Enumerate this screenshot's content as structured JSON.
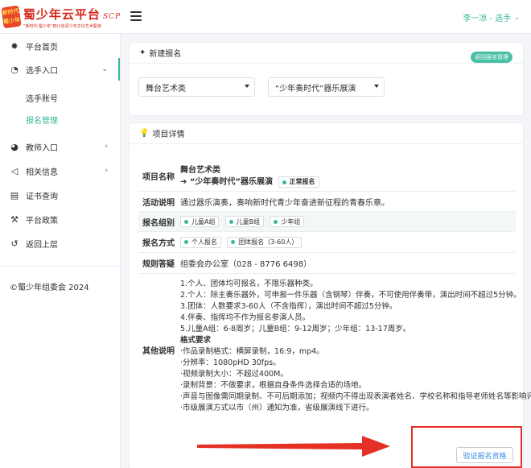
{
  "header": {
    "logo_badge": "新时代 蜀少年",
    "logo_title": "蜀少年云平台",
    "logo_scp": "SCP",
    "logo_subtitle": "“新时代·蜀少年”四川省青少年文化艺术展演",
    "user_label": "李一凉 - 选手"
  },
  "sidebar": {
    "items": [
      {
        "label": "平台首页",
        "icon": "gear-icon"
      },
      {
        "label": "选手入口",
        "icon": "dashboard-icon"
      },
      {
        "label": "教师入口",
        "icon": "palette-icon"
      },
      {
        "label": "相关信息",
        "icon": "megaphone-icon"
      },
      {
        "label": "证书查询",
        "icon": "certificate-icon"
      },
      {
        "label": "平台政策",
        "icon": "gavel-icon"
      },
      {
        "label": "返回上层",
        "icon": "back-icon"
      }
    ],
    "sub_items": [
      {
        "label": "选手账号"
      },
      {
        "label": "报名管理"
      }
    ],
    "copyright": "©蜀少年组委会 2024"
  },
  "new_signup": {
    "title": "新建报名",
    "back_button": "返回报名管理",
    "select_category": "舞台艺术类",
    "select_event": "“少年奏时代”器乐展演"
  },
  "details": {
    "title": "项目详情",
    "rows": {
      "project_name": {
        "label": "项目名称",
        "line1": "舞台艺术类",
        "line2": "➔ “少年奏时代”器乐展演",
        "status": "正常报名"
      },
      "activity": {
        "label": "活动说明",
        "value": "通过器乐演奏，奏响新时代青少年奋进新征程的青春乐章。"
      },
      "groups": {
        "label": "报名组别",
        "chips": [
          "儿童A组",
          "儿童B组",
          "少年组"
        ]
      },
      "methods": {
        "label": "报名方式",
        "chips": [
          "个人报名",
          "团体报名（3-60人）"
        ]
      },
      "rules": {
        "label": "规则答疑",
        "value": "组委会办公室（028 - 8776 6498）"
      },
      "other": {
        "label": "其他说明",
        "lines": [
          "1.个人、团体均可报名，不限乐器种类。",
          "2.个人：除主奏乐器外，可申报一件乐器（含钢琴）伴奏，不可使用伴奏带，演出时间不超过5分钟。",
          "3.团体：人数要求3-60人（不含指挥），演出时间不超过5分钟。",
          "4.伴奏、指挥均不作为报名参演人员。",
          "5.儿童A组：6-8周岁；儿童B组：9-12周岁；少年组：13-17周岁。",
          "格式要求",
          "·作品录制格式：横屏录制，16:9，mp4。",
          "·分辨率：1080pHD 30fps。",
          "·视频录制大小：不超过400M。",
          "·录制背景：不做要求，根据自身条件选择合适的场地。",
          "·声音与图像需同期录制、不可后期添加；视频内不得出现表演者姓名、学校名称和指导老师姓名等影响评",
          "·市级展演方式以市（州）通知为准，省级展演线下进行。"
        ]
      }
    }
  },
  "verify_button": "验证报名资格",
  "colors": {
    "accent": "#3ab79b",
    "brand_red": "#d7261c",
    "annotation_red": "#e53026"
  }
}
